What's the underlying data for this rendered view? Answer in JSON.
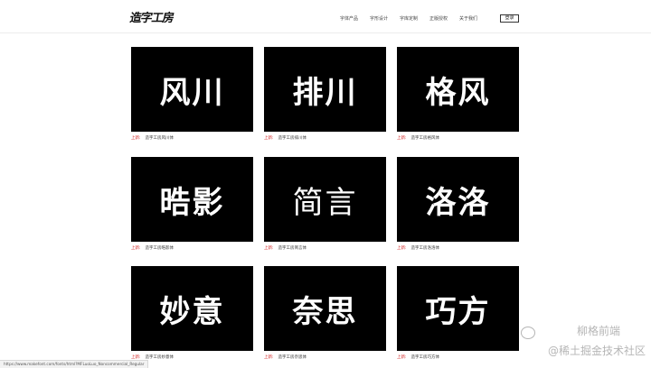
{
  "header": {
    "logo": "造字工房",
    "nav": [
      "字体产品",
      "字形设计",
      "字库定制",
      "正版授权",
      "关于我们"
    ],
    "login_label": "登录"
  },
  "cards": [
    {
      "glyphs": "风川",
      "tag": "上新:",
      "name": "造字工房风川体"
    },
    {
      "glyphs": "排川",
      "tag": "上新:",
      "name": "造字工房排川体"
    },
    {
      "glyphs": "格风",
      "tag": "上新:",
      "name": "造字工房格风体"
    },
    {
      "glyphs": "晧影",
      "tag": "上新:",
      "name": "造字工房晧影体"
    },
    {
      "glyphs": "简言",
      "tag": "上新:",
      "name": "造字工房简言体"
    },
    {
      "glyphs": "洛洛",
      "tag": "上新:",
      "name": "造字工房洛洛体"
    },
    {
      "glyphs": "妙意",
      "tag": "上新:",
      "name": "造字工房妙意体"
    },
    {
      "glyphs": "奈思",
      "tag": "上新:",
      "name": "造字工房奈思体"
    },
    {
      "glyphs": "巧方",
      "tag": "上新:",
      "name": "造字工房巧方体"
    }
  ],
  "status_url": "https://www.makefont.com/fonts/html?MFLuoLuo_Noncommercial_Regular",
  "watermark": {
    "line1": "柳格前端",
    "line2": "@稀土掘金技术社区"
  }
}
